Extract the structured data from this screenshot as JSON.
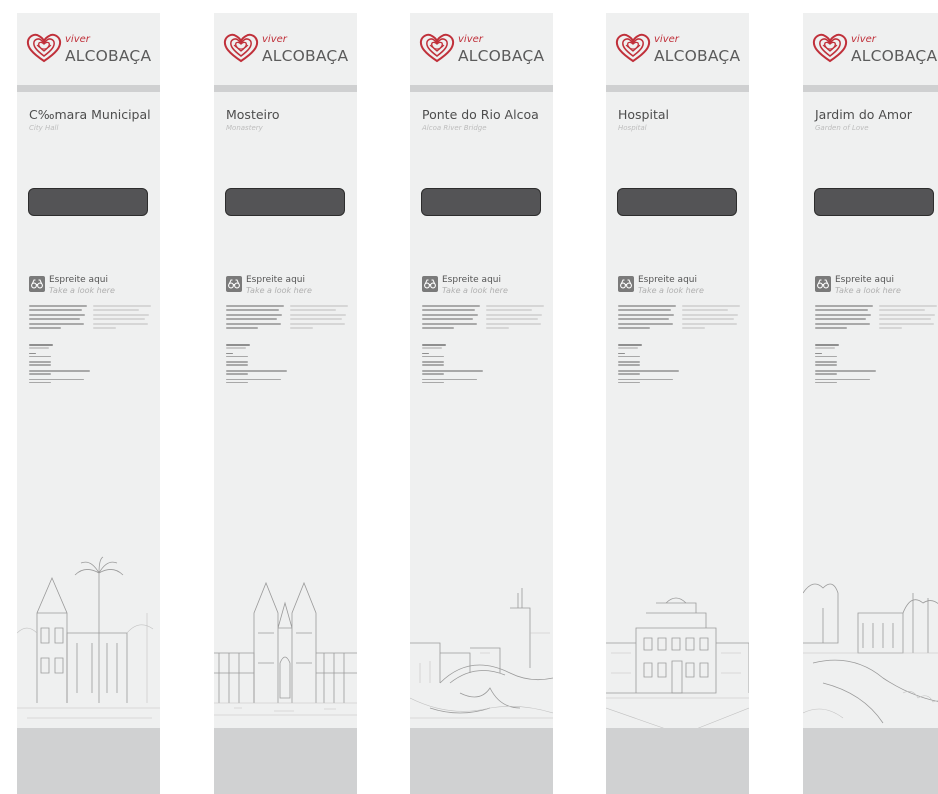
{
  "panels": [
    {
      "logo_top": "viver",
      "logo_name": "ALCOBAÇA",
      "title": "C‰mara Municipal",
      "subtitle": "City Hall",
      "peek_title": "Espreite aqui",
      "peek_subtitle": "Take a look here",
      "illustration": "city-hall-sketch"
    },
    {
      "logo_top": "viver",
      "logo_name": "ALCOBAÇA",
      "title": "Mosteiro",
      "subtitle": "Monastery",
      "peek_title": "Espreite aqui",
      "peek_subtitle": "Take a look here",
      "illustration": "monastery-sketch"
    },
    {
      "logo_top": "viver",
      "logo_name": "ALCOBAÇA",
      "title": "Ponte do Rio Alcoa",
      "subtitle": "Alcoa River Bridge",
      "peek_title": "Espreite aqui",
      "peek_subtitle": "Take a look here",
      "illustration": "bridge-sketch"
    },
    {
      "logo_top": "viver",
      "logo_name": "ALCOBAÇA",
      "title": "Hospital",
      "subtitle": "Hospital",
      "peek_title": "Espreite aqui",
      "peek_subtitle": "Take a look here",
      "illustration": "hospital-sketch"
    },
    {
      "logo_top": "viver",
      "logo_name": "ALCOBAÇA",
      "title": "Jardim do Amor",
      "subtitle": "Garden of Love",
      "peek_title": "Espreite aqui",
      "peek_subtitle": "Take a look here",
      "illustration": "garden-sketch"
    }
  ],
  "colors": {
    "brand_red": "#c0303a",
    "panel_bg": "#eff0f0",
    "band": "#cfd0d1",
    "viewer_screen": "#545456"
  },
  "icons": {
    "logo": "heart-logo-icon",
    "peek": "binoculars-icon"
  }
}
